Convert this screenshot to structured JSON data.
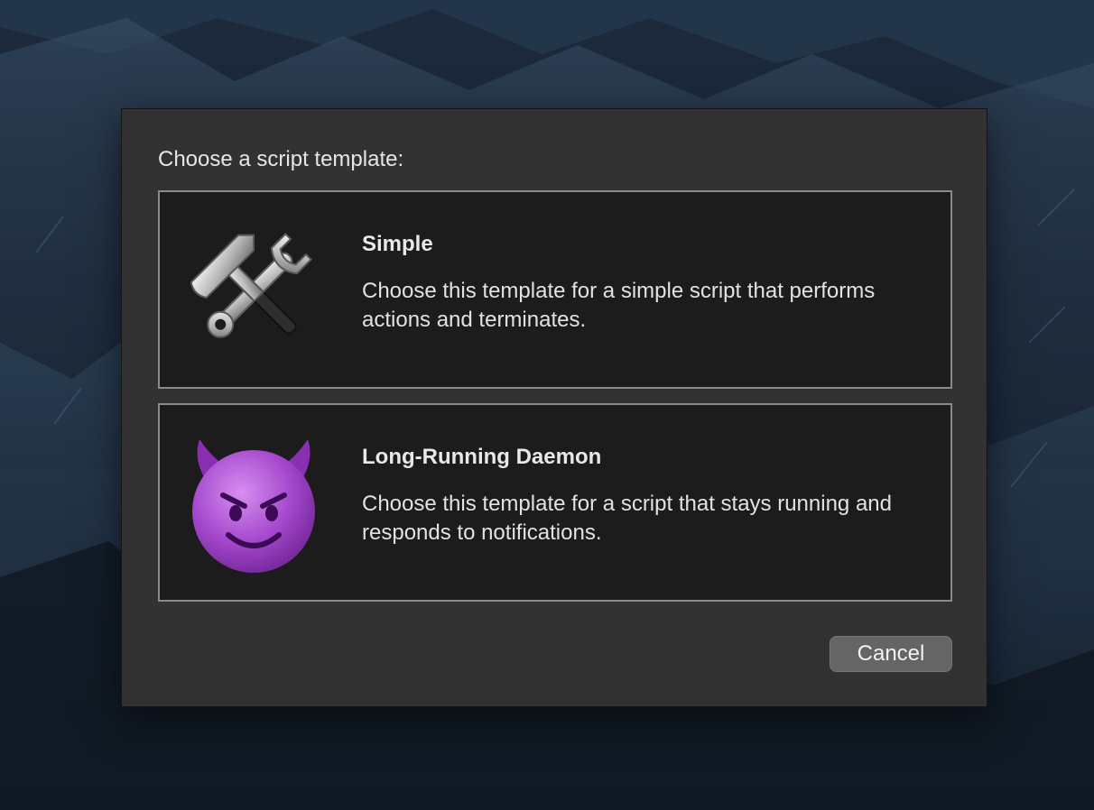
{
  "dialog": {
    "prompt": "Choose a script template:",
    "options": [
      {
        "title": "Simple",
        "description": "Choose this template for a simple script that performs actions and terminates.",
        "icon": "hammer-and-wrench-icon"
      },
      {
        "title": "Long-Running Daemon",
        "description": "Choose this template for a script that stays running and responds to notifications.",
        "icon": "smiling-devil-icon"
      }
    ],
    "cancel_label": "Cancel"
  },
  "colors": {
    "dialog_bg": "#323232",
    "option_bg": "#1c1c1c",
    "option_border": "#8a8a8a",
    "button_bg": "#656565",
    "devil_purple": "#9b3fc0"
  }
}
